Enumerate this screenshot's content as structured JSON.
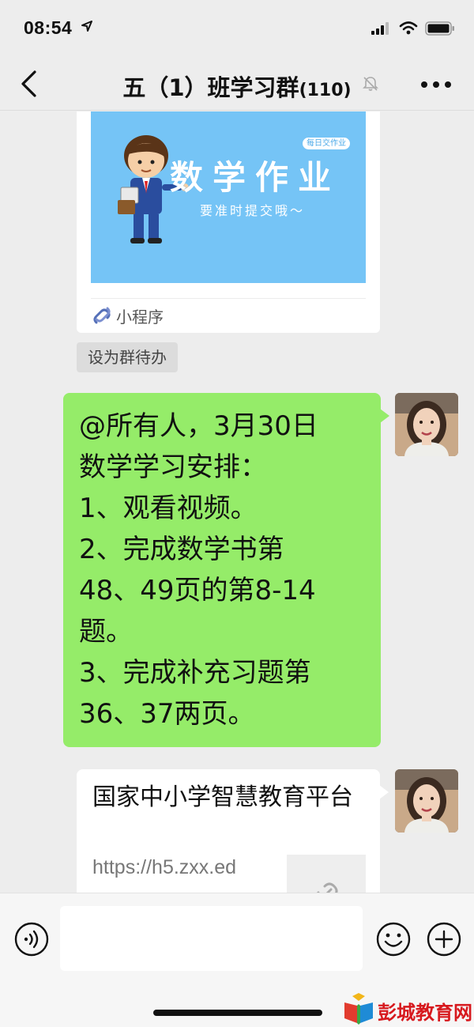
{
  "status_bar": {
    "time": "08:54",
    "icons": [
      "location-arrow-icon",
      "signal-icon",
      "wifi-icon",
      "battery-icon"
    ]
  },
  "nav": {
    "title": "五（1）班学习群",
    "member_count": "(110)",
    "icons": [
      "back-icon",
      "mute-bell-icon",
      "more-icon"
    ]
  },
  "messages": {
    "mini_program_card": {
      "badge": "每日交作业",
      "headline": "数学作业",
      "subtitle": "要准时提交哦～",
      "source_label": "小程序",
      "action_chip": "设为群待办"
    },
    "text_message": {
      "lines": [
        "@所有人，3月30日",
        "数学学习安排：",
        "1、观看视频。",
        "2、完成数学书第",
        "48、49页的第8-14",
        "题。",
        "3、完成补充习题第",
        "36、37两页。"
      ]
    },
    "link_card": {
      "title": "国家中小学智慧教育平台",
      "url": "https://h5.zxx.ed"
    }
  },
  "input_bar": {
    "placeholder": "",
    "icons": [
      "voice-icon",
      "emoji-icon",
      "plus-icon"
    ]
  },
  "watermark": {
    "text": "彭城教育网"
  },
  "colors": {
    "background": "#ededed",
    "bubble_green": "#95ec69",
    "mini_card_blue": "#75c4f6",
    "watermark_red": "#d7191e"
  }
}
